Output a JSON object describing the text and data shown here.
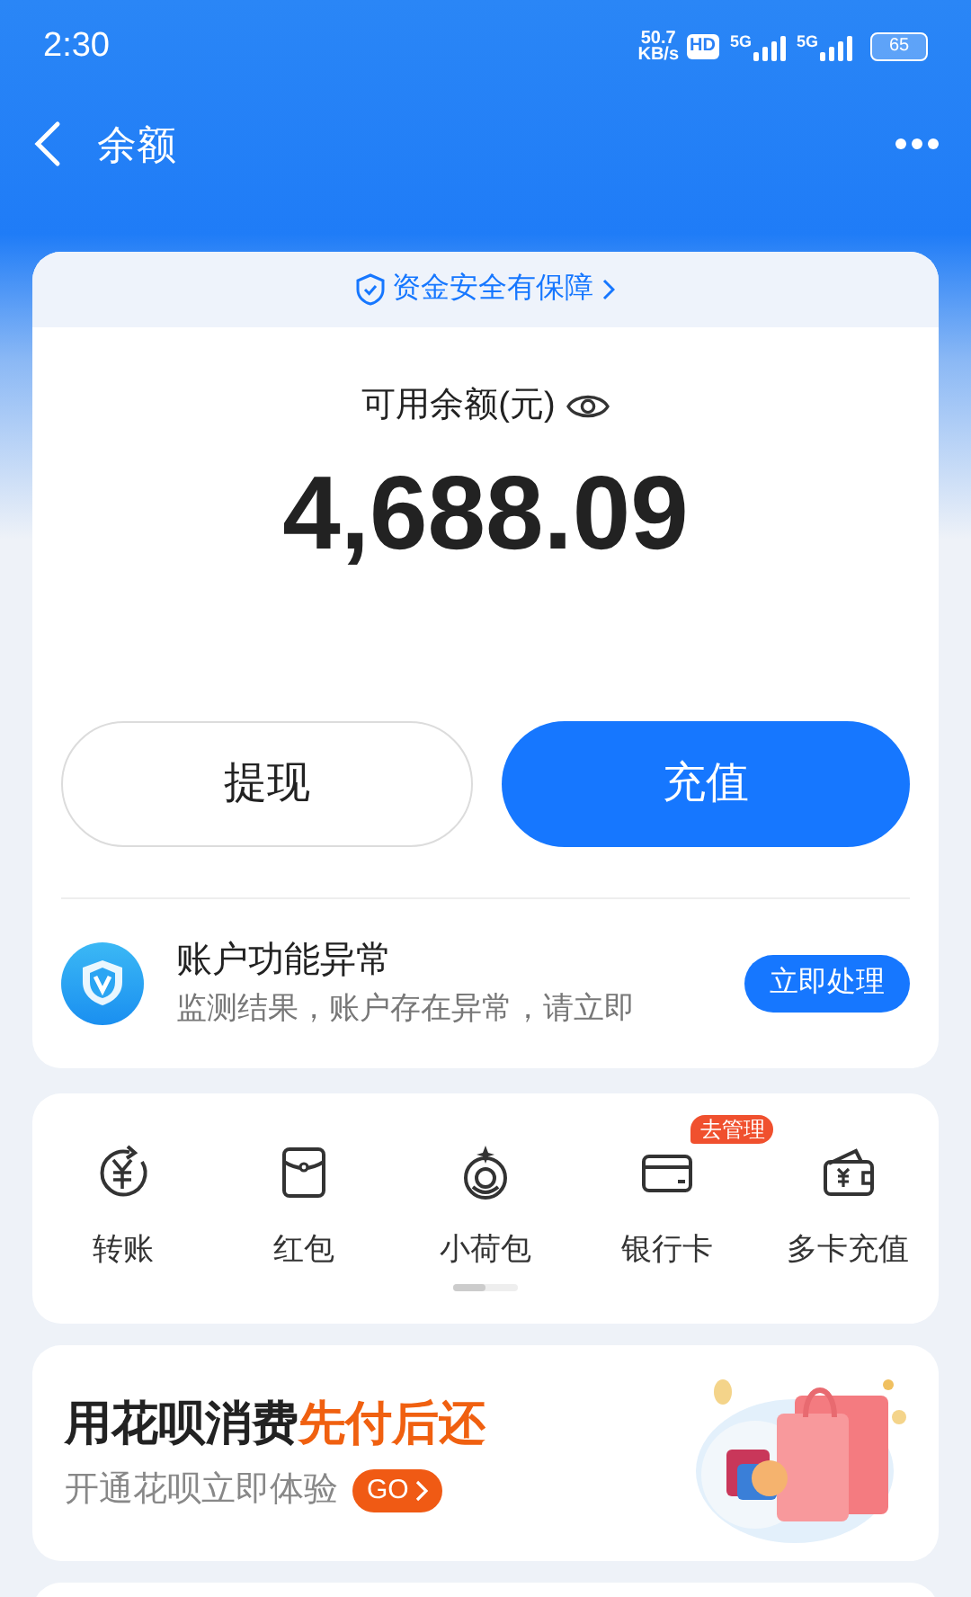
{
  "status_bar": {
    "time": "2:30",
    "net_speed": [
      "50.7",
      "KB/s"
    ],
    "hd_badge": "HD",
    "signals": [
      "5G",
      "5G"
    ],
    "battery": "65"
  },
  "nav": {
    "title": "余额"
  },
  "balance_card": {
    "security_note": "资金安全有保障",
    "label": "可用余额(元)",
    "amount": "4,688.09",
    "buttons": [
      {
        "label": "提现",
        "kind": "secondary"
      },
      {
        "label": "充值",
        "kind": "primary"
      }
    ],
    "notice": {
      "title": "账户功能异常",
      "message": "监测结果，账户存在异常，请立即",
      "action": "立即处理"
    }
  },
  "shortcuts": [
    {
      "label": "转账"
    },
    {
      "label": "红包"
    },
    {
      "label": "小荷包"
    },
    {
      "label": "银行卡",
      "badge": "去管理"
    },
    {
      "label": "多卡充值"
    }
  ],
  "banner": {
    "title": "用花呗消费",
    "title_highlight": "先付后还",
    "subtitle": "开通花呗立即体验",
    "action": "GO"
  }
}
